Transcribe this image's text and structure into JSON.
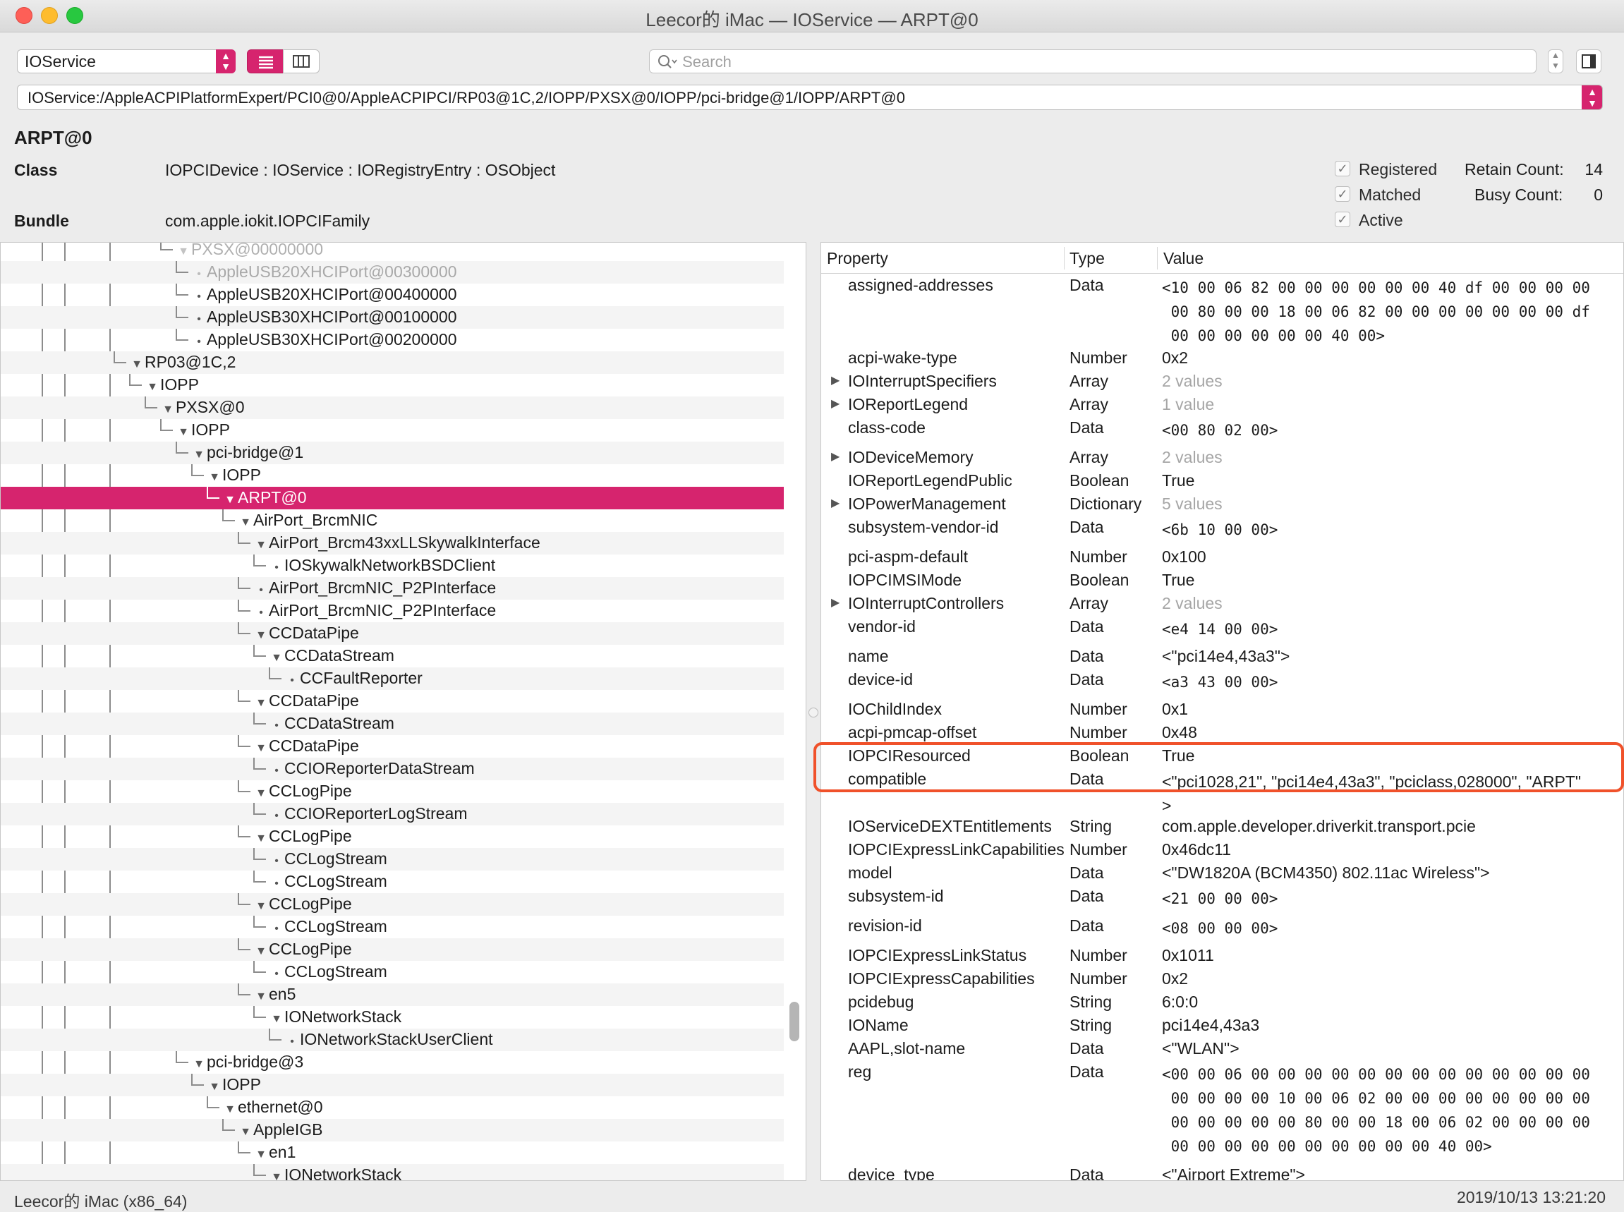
{
  "window": {
    "title": "Leecor的 iMac — IOService — ARPT@0"
  },
  "toolbar": {
    "plane": "IOService",
    "search_placeholder": "Search",
    "path": "IOService:/AppleACPIPlatformExpert/PCI0@0/AppleACPIPCI/RP03@1C,2/IOPP/PXSX@0/IOPP/pci-bridge@1/IOPP/ARPT@0",
    "icons": [
      "list-view-icon",
      "column-view-icon",
      "search-icon",
      "inspector-icon"
    ]
  },
  "object": {
    "name": "ARPT@0",
    "class_label": "Class",
    "class_value": "IOPCIDevice : IOService : IORegistryEntry : OSObject",
    "bundle_label": "Bundle",
    "bundle_value": "com.apple.iokit.IOPCIFamily",
    "flags": [
      {
        "label": "Registered",
        "checked": true
      },
      {
        "label": "Matched",
        "checked": true
      },
      {
        "label": "Active",
        "checked": true
      }
    ],
    "retain_label": "Retain Count:",
    "retain_value": "14",
    "busy_label": "Busy Count:",
    "busy_value": "0"
  },
  "tree": {
    "rows": [
      {
        "label": "PXSX@00000000",
        "depth": 4,
        "tri": "down"
      },
      {
        "label": "AppleUSB20XHCIPort@00300000",
        "depth": 5,
        "tri": "leaf"
      },
      {
        "label": "AppleUSB20XHCIPort@00400000",
        "depth": 5,
        "tri": "leaf"
      },
      {
        "label": "AppleUSB30XHCIPort@00100000",
        "depth": 5,
        "tri": "leaf"
      },
      {
        "label": "AppleUSB30XHCIPort@00200000",
        "depth": 5,
        "tri": "leaf"
      },
      {
        "label": "RP03@1C,2",
        "depth": 1,
        "tri": "down"
      },
      {
        "label": "IOPP",
        "depth": 2,
        "tri": "down"
      },
      {
        "label": "PXSX@0",
        "depth": 3,
        "tri": "down"
      },
      {
        "label": "IOPP",
        "depth": 4,
        "tri": "down"
      },
      {
        "label": "pci-bridge@1",
        "depth": 5,
        "tri": "down"
      },
      {
        "label": "IOPP",
        "depth": 6,
        "tri": "down"
      },
      {
        "label": "ARPT@0",
        "depth": 7,
        "tri": "down",
        "selected": true
      },
      {
        "label": "AirPort_BrcmNIC",
        "depth": 8,
        "tri": "down"
      },
      {
        "label": "AirPort_Brcm43xxLLSkywalkInterface",
        "depth": 9,
        "tri": "down"
      },
      {
        "label": "IOSkywalkNetworkBSDClient",
        "depth": 10,
        "tri": "leaf"
      },
      {
        "label": "AirPort_BrcmNIC_P2PInterface",
        "depth": 9,
        "tri": "leaf"
      },
      {
        "label": "AirPort_BrcmNIC_P2PInterface",
        "depth": 9,
        "tri": "leaf"
      },
      {
        "label": "CCDataPipe",
        "depth": 9,
        "tri": "down"
      },
      {
        "label": "CCDataStream",
        "depth": 10,
        "tri": "down"
      },
      {
        "label": "CCFaultReporter",
        "depth": 11,
        "tri": "leaf"
      },
      {
        "label": "CCDataPipe",
        "depth": 9,
        "tri": "down"
      },
      {
        "label": "CCDataStream",
        "depth": 10,
        "tri": "leaf"
      },
      {
        "label": "CCDataPipe",
        "depth": 9,
        "tri": "down"
      },
      {
        "label": "CCIOReporterDataStream",
        "depth": 10,
        "tri": "leaf"
      },
      {
        "label": "CCLogPipe",
        "depth": 9,
        "tri": "down"
      },
      {
        "label": "CCIOReporterLogStream",
        "depth": 10,
        "tri": "leaf"
      },
      {
        "label": "CCLogPipe",
        "depth": 9,
        "tri": "down"
      },
      {
        "label": "CCLogStream",
        "depth": 10,
        "tri": "leaf"
      },
      {
        "label": "CCLogStream",
        "depth": 10,
        "tri": "leaf"
      },
      {
        "label": "CCLogPipe",
        "depth": 9,
        "tri": "down"
      },
      {
        "label": "CCLogStream",
        "depth": 10,
        "tri": "leaf"
      },
      {
        "label": "CCLogPipe",
        "depth": 9,
        "tri": "down"
      },
      {
        "label": "CCLogStream",
        "depth": 10,
        "tri": "leaf"
      },
      {
        "label": "en5",
        "depth": 9,
        "tri": "down"
      },
      {
        "label": "IONetworkStack",
        "depth": 10,
        "tri": "down"
      },
      {
        "label": "IONetworkStackUserClient",
        "depth": 11,
        "tri": "leaf"
      },
      {
        "label": "pci-bridge@3",
        "depth": 5,
        "tri": "down"
      },
      {
        "label": "IOPP",
        "depth": 6,
        "tri": "down"
      },
      {
        "label": "ethernet@0",
        "depth": 7,
        "tri": "down"
      },
      {
        "label": "AppleIGB",
        "depth": 8,
        "tri": "down"
      },
      {
        "label": "en1",
        "depth": 9,
        "tri": "down"
      },
      {
        "label": "IONetworkStack",
        "depth": 10,
        "tri": "down"
      }
    ]
  },
  "properties": {
    "headers": {
      "property": "Property",
      "type": "Type",
      "value": "Value"
    },
    "rows": [
      {
        "name": "assigned-addresses",
        "type": "Data",
        "value": "<10 00 06 82 00 00 00 00 00 00 40 df 00 00 00 00\n 00 80 00 00 18 00 06 82 00 00 00 00 00 00 00 df\n 00 00 00 00 00 00 40 00>",
        "mono": true,
        "lines": 3
      },
      {
        "name": "acpi-wake-type",
        "type": "Number",
        "value": "0x2"
      },
      {
        "name": "IOInterruptSpecifiers",
        "type": "Array",
        "value": "2 values",
        "muted": true,
        "expand": true
      },
      {
        "name": "IOReportLegend",
        "type": "Array",
        "value": "1 value",
        "muted": true,
        "expand": true
      },
      {
        "name": "class-code",
        "type": "Data",
        "value": "<00 80 02 00>",
        "mono": true,
        "lines": 1.15
      },
      {
        "name": "IODeviceMemory",
        "type": "Array",
        "value": "2 values",
        "muted": true,
        "expand": true
      },
      {
        "name": "IOReportLegendPublic",
        "type": "Boolean",
        "value": "True"
      },
      {
        "name": "IOPowerManagement",
        "type": "Dictionary",
        "value": "5 values",
        "muted": true,
        "expand": true
      },
      {
        "name": "subsystem-vendor-id",
        "type": "Data",
        "value": "<6b 10 00 00>",
        "mono": true,
        "lines": 1.15
      },
      {
        "name": "pci-aspm-default",
        "type": "Number",
        "value": "0x100"
      },
      {
        "name": "IOPCIMSIMode",
        "type": "Boolean",
        "value": "True"
      },
      {
        "name": "IOInterruptControllers",
        "type": "Array",
        "value": "2 values",
        "muted": true,
        "expand": true
      },
      {
        "name": "vendor-id",
        "type": "Data",
        "value": "<e4 14 00 00>",
        "mono": true,
        "lines": 1.15
      },
      {
        "name": "name",
        "type": "Data",
        "value": "<\"pci14e4,43a3\">"
      },
      {
        "name": "device-id",
        "type": "Data",
        "value": "<a3 43 00 00>",
        "mono": true,
        "lines": 1.15
      },
      {
        "name": "IOChildIndex",
        "type": "Number",
        "value": "0x1"
      },
      {
        "name": "acpi-pmcap-offset",
        "type": "Number",
        "value": "0x48"
      },
      {
        "name": "IOPCIResourced",
        "type": "Boolean",
        "value": "True"
      },
      {
        "name": "compatible",
        "type": "Data",
        "value": "<\"pci1028,21\", \"pci14e4,43a3\", \"pciclass,028000\", \"ARPT\"\n>",
        "lines": 1.9
      },
      {
        "name": "IOServiceDEXTEntitlements",
        "type": "String",
        "value": "com.apple.developer.driverkit.transport.pcie"
      },
      {
        "name": "IOPCIExpressLinkCapabilities",
        "type": "Number",
        "value": "0x46dc11"
      },
      {
        "name": "model",
        "type": "Data",
        "value": "<\"DW1820A (BCM4350) 802.11ac Wireless\">"
      },
      {
        "name": "subsystem-id",
        "type": "Data",
        "value": "<21 00 00 00>",
        "mono": true,
        "lines": 1.15
      },
      {
        "name": "revision-id",
        "type": "Data",
        "value": "<08 00 00 00>",
        "mono": true,
        "lines": 1.15
      },
      {
        "name": "IOPCIExpressLinkStatus",
        "type": "Number",
        "value": "0x1011"
      },
      {
        "name": "IOPCIExpressCapabilities",
        "type": "Number",
        "value": "0x2"
      },
      {
        "name": "pcidebug",
        "type": "String",
        "value": "6:0:0"
      },
      {
        "name": "IOName",
        "type": "String",
        "value": "pci14e4,43a3"
      },
      {
        "name": "AAPL,slot-name",
        "type": "Data",
        "value": "<\"WLAN\">"
      },
      {
        "name": "reg",
        "type": "Data",
        "value": "<00 00 06 00 00 00 00 00 00 00 00 00 00 00 00 00\n 00 00 00 00 10 00 06 02 00 00 00 00 00 00 00 00\n 00 00 00 00 00 80 00 00 18 00 06 02 00 00 00 00\n 00 00 00 00 00 00 00 00 00 00 40 00>",
        "mono": true,
        "lines": 4.3
      },
      {
        "name": "device_type",
        "type": "Data",
        "value": "<\"Airport Extreme\">"
      }
    ]
  },
  "status": {
    "machine": "Leecor的 iMac (x86_64)",
    "timestamp": "2019/10/13 13:21:20"
  }
}
